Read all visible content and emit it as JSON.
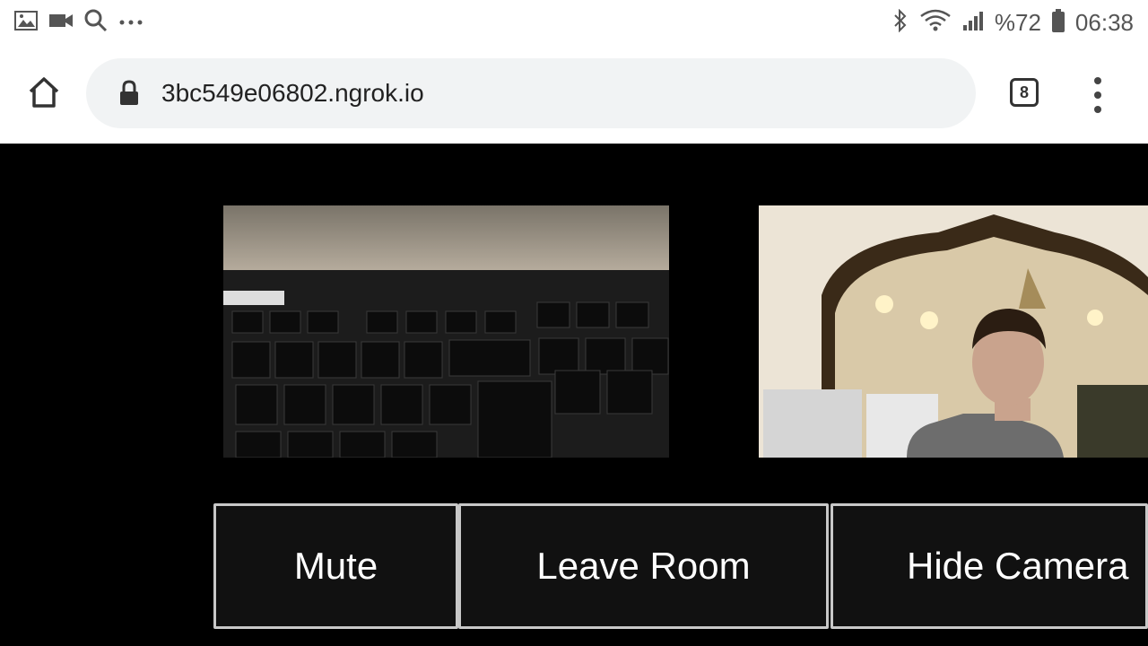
{
  "status_bar": {
    "left_icons": [
      "gallery-icon",
      "video-icon",
      "search-icon",
      "more-icon"
    ],
    "right_icons": [
      "bluetooth-icon",
      "wifi-icon",
      "signal-icon"
    ],
    "battery": "%72",
    "time": "06:38"
  },
  "browser": {
    "url": "3bc549e06802.ngrok.io",
    "tab_count": "8"
  },
  "controls": {
    "mute_label": "Mute",
    "leave_label": "Leave Room",
    "hide_camera_label": "Hide Camera"
  }
}
